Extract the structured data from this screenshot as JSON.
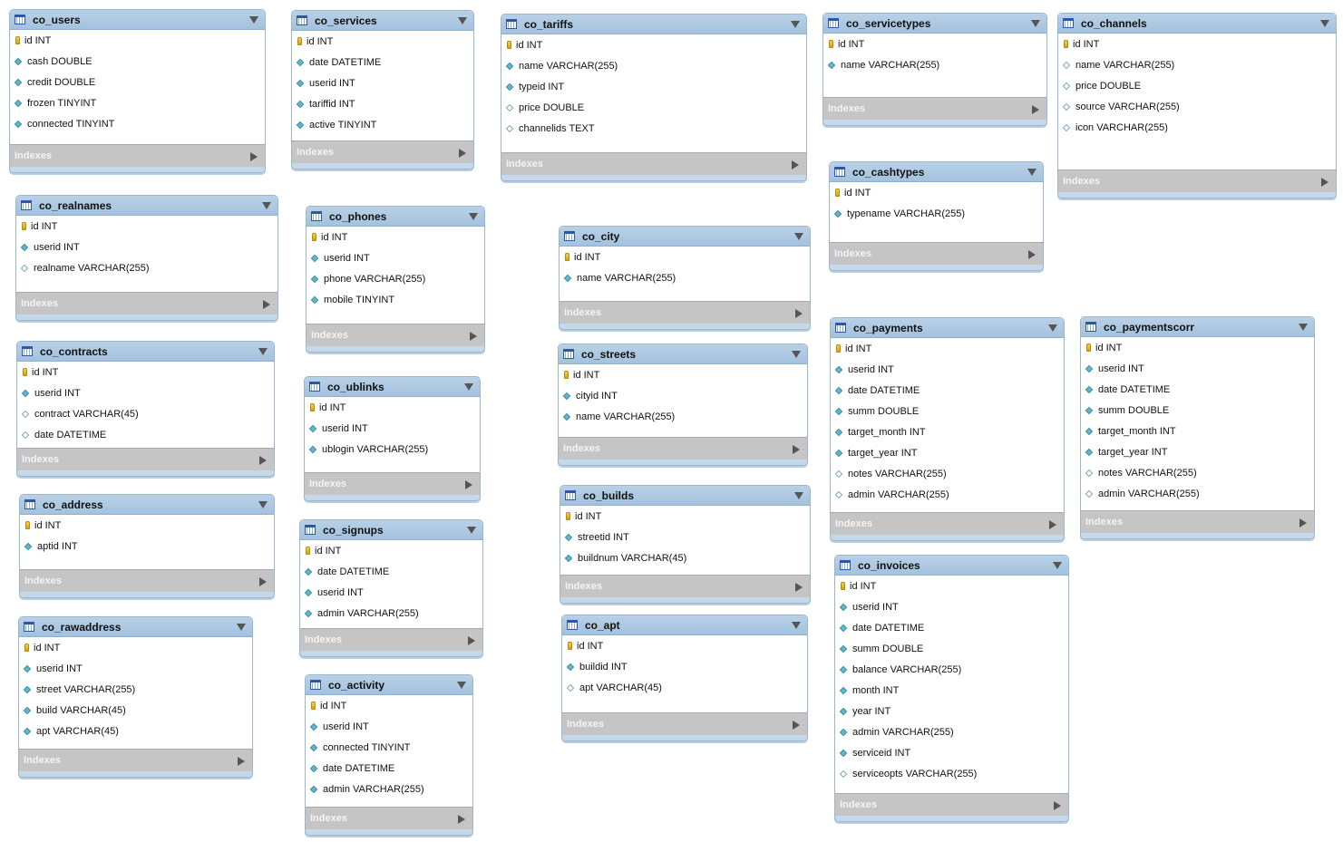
{
  "tables": [
    {
      "name": "co_users",
      "columns": [
        {
          "text": "id INT",
          "kind": "pk"
        },
        {
          "text": "cash DOUBLE",
          "kind": "nn"
        },
        {
          "text": "credit DOUBLE",
          "kind": "nn"
        },
        {
          "text": "frozen TINYINT",
          "kind": "nn"
        },
        {
          "text": "connected TINYINT",
          "kind": "nn"
        }
      ],
      "indexes_label": "Indexes"
    },
    {
      "name": "co_services",
      "columns": [
        {
          "text": "id INT",
          "kind": "pk"
        },
        {
          "text": "date DATETIME",
          "kind": "nn"
        },
        {
          "text": "userid INT",
          "kind": "nn"
        },
        {
          "text": "tariffid INT",
          "kind": "nn"
        },
        {
          "text": "active TINYINT",
          "kind": "nn"
        }
      ],
      "indexes_label": "Indexes"
    },
    {
      "name": "co_tariffs",
      "columns": [
        {
          "text": "id INT",
          "kind": "pk"
        },
        {
          "text": "name VARCHAR(255)",
          "kind": "nn"
        },
        {
          "text": "typeid INT",
          "kind": "nn"
        },
        {
          "text": "price DOUBLE",
          "kind": "null"
        },
        {
          "text": "channelids TEXT",
          "kind": "null"
        }
      ],
      "indexes_label": "Indexes"
    },
    {
      "name": "co_servicetypes",
      "columns": [
        {
          "text": "id INT",
          "kind": "pk"
        },
        {
          "text": "name VARCHAR(255)",
          "kind": "nn"
        }
      ],
      "indexes_label": "Indexes"
    },
    {
      "name": "co_channels",
      "columns": [
        {
          "text": "id INT",
          "kind": "pk"
        },
        {
          "text": "name VARCHAR(255)",
          "kind": "null"
        },
        {
          "text": "price DOUBLE",
          "kind": "null"
        },
        {
          "text": "source VARCHAR(255)",
          "kind": "null"
        },
        {
          "text": "icon VARCHAR(255)",
          "kind": "null"
        }
      ],
      "indexes_label": "Indexes"
    },
    {
      "name": "co_cashtypes",
      "columns": [
        {
          "text": "id INT",
          "kind": "pk"
        },
        {
          "text": "typename VARCHAR(255)",
          "kind": "nn"
        }
      ],
      "indexes_label": "Indexes"
    },
    {
      "name": "co_realnames",
      "columns": [
        {
          "text": "id INT",
          "kind": "pk"
        },
        {
          "text": "userid INT",
          "kind": "nn"
        },
        {
          "text": "realname VARCHAR(255)",
          "kind": "null"
        }
      ],
      "indexes_label": "Indexes"
    },
    {
      "name": "co_phones",
      "columns": [
        {
          "text": "id INT",
          "kind": "pk"
        },
        {
          "text": "userid INT",
          "kind": "nn"
        },
        {
          "text": "phone VARCHAR(255)",
          "kind": "nn"
        },
        {
          "text": "mobile TINYINT",
          "kind": "nn"
        }
      ],
      "indexes_label": "Indexes"
    },
    {
      "name": "co_city",
      "columns": [
        {
          "text": "id INT",
          "kind": "pk"
        },
        {
          "text": "name VARCHAR(255)",
          "kind": "nn"
        }
      ],
      "indexes_label": "Indexes"
    },
    {
      "name": "co_contracts",
      "columns": [
        {
          "text": "id INT",
          "kind": "pk"
        },
        {
          "text": "userid INT",
          "kind": "nn"
        },
        {
          "text": "contract VARCHAR(45)",
          "kind": "null"
        },
        {
          "text": "date DATETIME",
          "kind": "null"
        }
      ],
      "indexes_label": "Indexes"
    },
    {
      "name": "co_ublinks",
      "columns": [
        {
          "text": "id INT",
          "kind": "pk"
        },
        {
          "text": "userid INT",
          "kind": "nn"
        },
        {
          "text": "ublogin VARCHAR(255)",
          "kind": "nn"
        }
      ],
      "indexes_label": "Indexes"
    },
    {
      "name": "co_streets",
      "columns": [
        {
          "text": "id INT",
          "kind": "pk"
        },
        {
          "text": "cityid INT",
          "kind": "nn"
        },
        {
          "text": "name VARCHAR(255)",
          "kind": "nn"
        }
      ],
      "indexes_label": "Indexes"
    },
    {
      "name": "co_payments",
      "columns": [
        {
          "text": "id INT",
          "kind": "pk"
        },
        {
          "text": "userid INT",
          "kind": "nn"
        },
        {
          "text": "date DATETIME",
          "kind": "nn"
        },
        {
          "text": "summ DOUBLE",
          "kind": "nn"
        },
        {
          "text": "target_month INT",
          "kind": "nn"
        },
        {
          "text": "target_year INT",
          "kind": "nn"
        },
        {
          "text": "notes VARCHAR(255)",
          "kind": "null"
        },
        {
          "text": "admin VARCHAR(255)",
          "kind": "null"
        }
      ],
      "indexes_label": "Indexes"
    },
    {
      "name": "co_paymentscorr",
      "columns": [
        {
          "text": "id INT",
          "kind": "pk"
        },
        {
          "text": "userid INT",
          "kind": "nn"
        },
        {
          "text": "date DATETIME",
          "kind": "nn"
        },
        {
          "text": "summ DOUBLE",
          "kind": "nn"
        },
        {
          "text": "target_month INT",
          "kind": "nn"
        },
        {
          "text": "target_year INT",
          "kind": "nn"
        },
        {
          "text": "notes VARCHAR(255)",
          "kind": "null"
        },
        {
          "text": "admin VARCHAR(255)",
          "kind": "null"
        }
      ],
      "indexes_label": "Indexes"
    },
    {
      "name": "co_address",
      "columns": [
        {
          "text": "id INT",
          "kind": "pk"
        },
        {
          "text": "aptid INT",
          "kind": "nn"
        }
      ],
      "indexes_label": "Indexes"
    },
    {
      "name": "co_signups",
      "columns": [
        {
          "text": "id INT",
          "kind": "pk"
        },
        {
          "text": "date DATETIME",
          "kind": "nn"
        },
        {
          "text": "userid INT",
          "kind": "nn"
        },
        {
          "text": "admin VARCHAR(255)",
          "kind": "nn"
        }
      ],
      "indexes_label": "Indexes"
    },
    {
      "name": "co_builds",
      "columns": [
        {
          "text": "id INT",
          "kind": "pk"
        },
        {
          "text": "streetid INT",
          "kind": "nn"
        },
        {
          "text": "buildnum VARCHAR(45)",
          "kind": "nn"
        }
      ],
      "indexes_label": "Indexes"
    },
    {
      "name": "co_invoices",
      "columns": [
        {
          "text": "id INT",
          "kind": "pk"
        },
        {
          "text": "userid INT",
          "kind": "nn"
        },
        {
          "text": "date DATETIME",
          "kind": "nn"
        },
        {
          "text": "summ DOUBLE",
          "kind": "nn"
        },
        {
          "text": "balance VARCHAR(255)",
          "kind": "nn"
        },
        {
          "text": "month INT",
          "kind": "nn"
        },
        {
          "text": "year INT",
          "kind": "nn"
        },
        {
          "text": "admin VARCHAR(255)",
          "kind": "nn"
        },
        {
          "text": "serviceid INT",
          "kind": "nn"
        },
        {
          "text": "serviceopts VARCHAR(255)",
          "kind": "null"
        }
      ],
      "indexes_label": "Indexes"
    },
    {
      "name": "co_rawaddress",
      "columns": [
        {
          "text": "id INT",
          "kind": "pk"
        },
        {
          "text": "userid INT",
          "kind": "nn"
        },
        {
          "text": "street VARCHAR(255)",
          "kind": "nn"
        },
        {
          "text": "build VARCHAR(45)",
          "kind": "nn"
        },
        {
          "text": "apt VARCHAR(45)",
          "kind": "nn"
        }
      ],
      "indexes_label": "Indexes"
    },
    {
      "name": "co_apt",
      "columns": [
        {
          "text": "id INT",
          "kind": "pk"
        },
        {
          "text": "buildid INT",
          "kind": "nn"
        },
        {
          "text": "apt VARCHAR(45)",
          "kind": "null"
        }
      ],
      "indexes_label": "Indexes"
    },
    {
      "name": "co_activity",
      "columns": [
        {
          "text": "id INT",
          "kind": "pk"
        },
        {
          "text": "userid INT",
          "kind": "nn"
        },
        {
          "text": "connected TINYINT",
          "kind": "nn"
        },
        {
          "text": "date DATETIME",
          "kind": "nn"
        },
        {
          "text": "admin VARCHAR(255)",
          "kind": "nn"
        }
      ],
      "indexes_label": "Indexes"
    }
  ]
}
